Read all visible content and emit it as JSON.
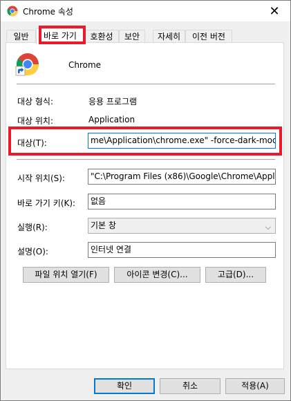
{
  "window": {
    "title": "Chrome 속성",
    "close_icon": "close-icon"
  },
  "tabs": [
    {
      "label": "일반",
      "active": false
    },
    {
      "label": "바로 가기",
      "active": true
    },
    {
      "label": "호환성",
      "active": false
    },
    {
      "label": "보안",
      "active": false
    },
    {
      "label": "자세히",
      "active": false
    },
    {
      "label": "이전 버전",
      "active": false
    }
  ],
  "shortcut": {
    "app_name": "Chrome",
    "target_type_label": "대상 형식:",
    "target_type_value": "응용 프로그램",
    "target_location_label": "대상 위치:",
    "target_location_value": "Application",
    "target_label": "대상(T):",
    "target_value": "me\\Application\\chrome.exe\" -force-dark-mode",
    "start_in_label": "시작 위치(S):",
    "start_in_value": "\"C:\\Program Files (x86)\\Google\\Chrome\\Appli",
    "shortcut_key_label": "바로 가기 키(K):",
    "shortcut_key_value": "없음",
    "run_label": "실행(R):",
    "run_value": "기본 창",
    "comment_label": "설명(O):",
    "comment_value": "인터넷 연결",
    "open_location_button": "파일 위치 열기(F)",
    "change_icon_button": "아이콘 변경(C)...",
    "advanced_button": "고급(D)..."
  },
  "footer": {
    "ok": "확인",
    "cancel": "취소",
    "apply": "적용(A)"
  },
  "colors": {
    "highlight": "#e81a2b",
    "focus": "#0078d7"
  }
}
